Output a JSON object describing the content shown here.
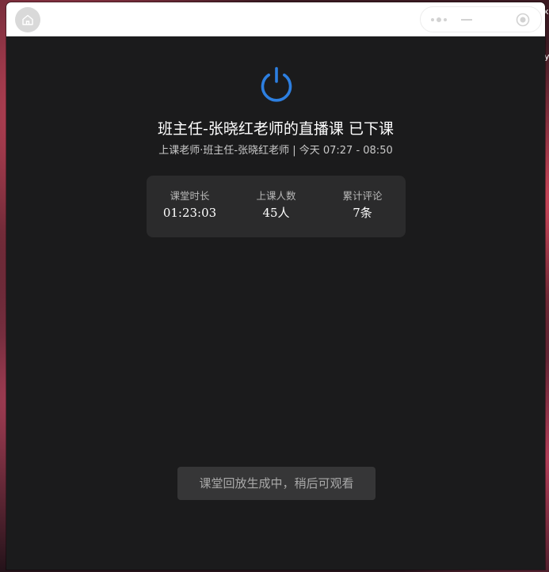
{
  "colors": {
    "accent": "#2d7fe0",
    "window_bg": "#1b1b1c",
    "card_bg": "#2b2b2c",
    "button_bg": "#363637"
  },
  "titlebar": {
    "home_icon": "home-icon",
    "capsule_icons": [
      "more-dots-icon",
      "minimize-icon",
      "close-target-icon"
    ]
  },
  "live": {
    "status_icon": "power-icon",
    "title": "班主任-张晓红老师的直播课 已下课",
    "subtitle": "上课老师·班主任-张晓红老师 | 今天 07:27 - 08:50"
  },
  "stats": [
    {
      "label": "课堂时长",
      "value": "01:23:03"
    },
    {
      "label": "上课人数",
      "value": "45人"
    },
    {
      "label": "累计评论",
      "value": "7条"
    }
  ],
  "replay": {
    "label": "课堂回放生成中，稍后可观看"
  }
}
